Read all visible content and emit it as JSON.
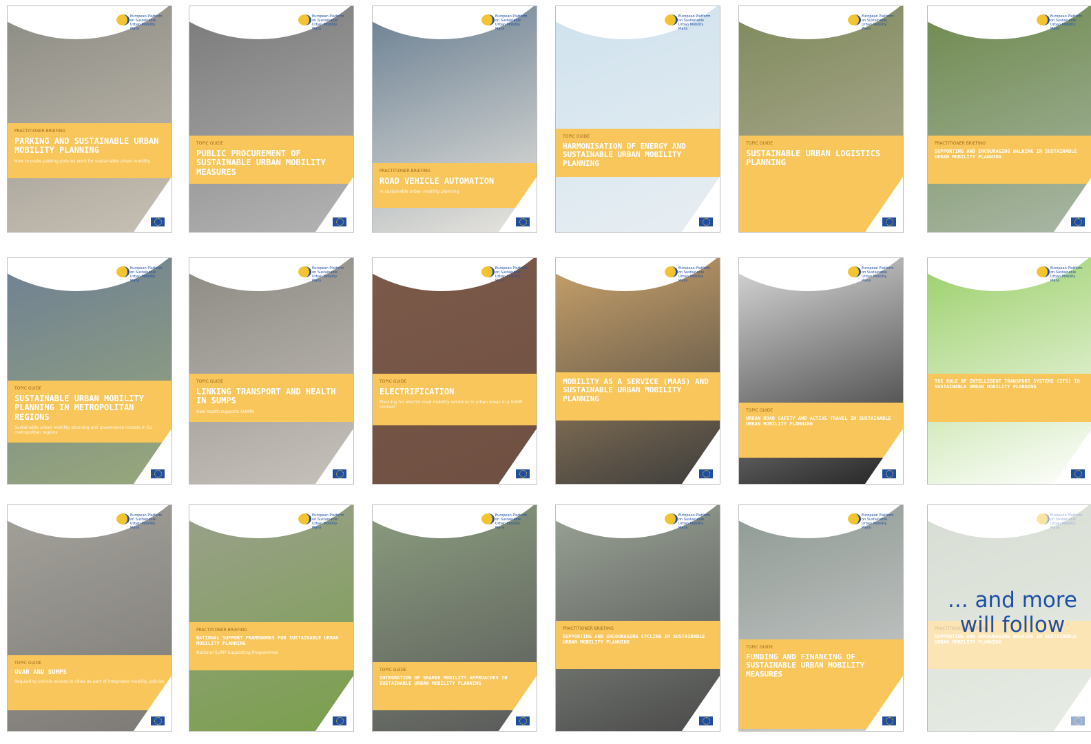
{
  "org": {
    "logo_text": "European Platform on Sustainable Urban Mobility Plans"
  },
  "covers": [
    {
      "kicker": "Practitioner Briefing",
      "title": "PARKING AND SUSTAINABLE URBAN MOBILITY PLANNING",
      "subtitle": "How to make parking policies work for sustainable urban mobility",
      "photo": "#8c8c84",
      "photo2": "#c8c0b4"
    },
    {
      "kicker": "Topic Guide",
      "title": "PUBLIC PROCUREMENT OF SUSTAINABLE URBAN MOBILITY MEASURES",
      "subtitle": "",
      "photo": "#7a7a7a",
      "photo2": "#b4b4b4"
    },
    {
      "kicker": "Practitioner Briefing",
      "title": "ROAD VEHICLE AUTOMATION",
      "subtitle": "in sustainable urban mobility planning",
      "photo": "#6a7f92",
      "photo2": "#e9e6df"
    },
    {
      "kicker": "Topic Guide",
      "title": "HARMONISATION OF ENERGY AND SUSTAINABLE URBAN MOBILITY PLANNING",
      "subtitle": "",
      "photo": "#cfe2ee",
      "photo2": "#e8eef2"
    },
    {
      "kicker": "Topic Guide",
      "title": "SUSTAINABLE URBAN LOGISTICS PLANNING",
      "subtitle": "",
      "photo": "#7e8a5c",
      "photo2": "#b6b09a"
    },
    {
      "kicker": "Practitioner Briefing",
      "title": "SUPPORTING AND ENCOURAGING WALKING IN SUSTAINABLE URBAN MOBILITY PLANNING",
      "subtitle": "",
      "photo": "#6f8a4e",
      "photo2": "#a9b7a6"
    },
    {
      "kicker": "Topic Guide",
      "title": "SUSTAINABLE URBAN MOBILITY PLANNING IN METROPOLITAN REGIONS",
      "subtitle": "Sustainable urban mobility planning and governance models in EU metropolitan regions",
      "photo": "#6f8094",
      "photo2": "#98a87a"
    },
    {
      "kicker": "Topic Guide",
      "title": "LINKING TRANSPORT AND HEALTH IN SUMPS",
      "subtitle": "How health supports SUMPs",
      "photo": "#8d8a84",
      "photo2": "#c7c2bb"
    },
    {
      "kicker": "Topic Guide",
      "title": "ELECTRIFICATION",
      "subtitle": "Planning for electric road mobility solutions in urban areas in a SUMP context",
      "photo": "#7c5a4a",
      "photo2": "#6e4f41"
    },
    {
      "kicker": "",
      "title": "MOBILITY AS A SERVICE (MAAS) AND SUSTAINABLE URBAN MOBILITY PLANNING",
      "subtitle": "",
      "photo": "#c9a26b",
      "photo2": "#3c3c3c"
    },
    {
      "kicker": "Topic Guide",
      "title": "URBAN ROAD SAFETY AND ACTIVE TRAVEL IN SUSTAINABLE URBAN MOBILITY PLANNING",
      "subtitle": "",
      "photo": "#d9d9d9",
      "photo2": "#222222"
    },
    {
      "kicker": "",
      "title": "THE ROLE OF INTELLIGENT TRANSPORT SYSTEMS (ITS) IN SUSTAINABLE URBAN MOBILITY PLANNING",
      "subtitle": "",
      "photo": "#9ccf6a",
      "photo2": "#ffffff"
    },
    {
      "kicker": "Topic Guide",
      "title": "UVAR and SUMPs",
      "subtitle": "Regulating vehicle access to cities as part of integrated mobility policies",
      "photo": "#a3a19a",
      "photo2": "#7d7a76"
    },
    {
      "kicker": "Practitioner Briefing",
      "title": "NATIONAL SUPPORT FRAMEWORKS FOR SUSTAINABLE URBAN MOBILITY PLANNING",
      "subtitle": "National SUMP Supporting Programmes",
      "photo": "#9aa08c",
      "photo2": "#7aa04c"
    },
    {
      "kicker": "Topic Guide",
      "title": "INTEGRATION OF SHARED MOBILITY APPROACHES IN SUSTAINABLE URBAN MOBILITY PLANNING",
      "subtitle": "",
      "photo": "#8a9c7e",
      "photo2": "#5a5a5a"
    },
    {
      "kicker": "Practitioner Briefing",
      "title": "SUPPORTING AND ENCOURAGING CYCLING IN SUSTAINABLE URBAN MOBILITY PLANNING",
      "subtitle": "",
      "photo": "#9aa396",
      "photo2": "#4a4a4a"
    },
    {
      "kicker": "Topic Guide",
      "title": "FUNDING AND FINANCING OF SUSTAINABLE URBAN MOBILITY MEASURES",
      "subtitle": "",
      "photo": "#8f9a94",
      "photo2": "#cfcfcf"
    },
    {
      "kicker": "Practitioner Briefing",
      "title": "SUPPORTING AND ENCOURAGING WALKING IN SUSTAINABLE URBAN MOBILITY PLANNING",
      "subtitle": "",
      "photo": "#a8b5a0",
      "photo2": "#cad5c3"
    }
  ],
  "overlay": {
    "follow_line1": "... and more",
    "follow_line2": "will follow"
  }
}
